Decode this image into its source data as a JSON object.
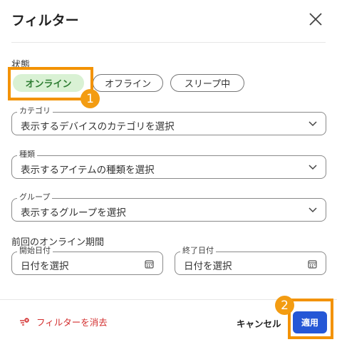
{
  "dialog": {
    "title": "フィルター"
  },
  "status": {
    "label": "状態",
    "chips": [
      {
        "label": "オンライン",
        "active": true
      },
      {
        "label": "オフライン",
        "active": false
      },
      {
        "label": "スリープ中",
        "active": false
      }
    ]
  },
  "category": {
    "label": "カテゴリ",
    "placeholder": "表示するデバイスのカテゴリを選択"
  },
  "kind": {
    "label": "種類",
    "placeholder": "表示するアイテムの種類を選択"
  },
  "group": {
    "label": "グループ",
    "placeholder": "表示するグループを選択"
  },
  "period": {
    "label": "前回のオンライン期間",
    "start": {
      "label": "開始日付",
      "placeholder": "日付を選択"
    },
    "end": {
      "label": "終了日付",
      "placeholder": "日付を選択"
    }
  },
  "footer": {
    "clear_label": "フィルターを消去",
    "cancel_label": "キャンセル",
    "apply_label": "適用"
  },
  "annotations": {
    "badge1": "1",
    "badge2": "2"
  },
  "colors": {
    "accent": "#2557d6",
    "chip_active_bg": "#d9f1d4",
    "chip_active_text": "#2e7d32",
    "highlight": "#f39200",
    "danger": "#d32f2f"
  },
  "icons": [
    "close-icon",
    "chevron-down-icon",
    "calendar-icon",
    "filter-clear-icon"
  ]
}
